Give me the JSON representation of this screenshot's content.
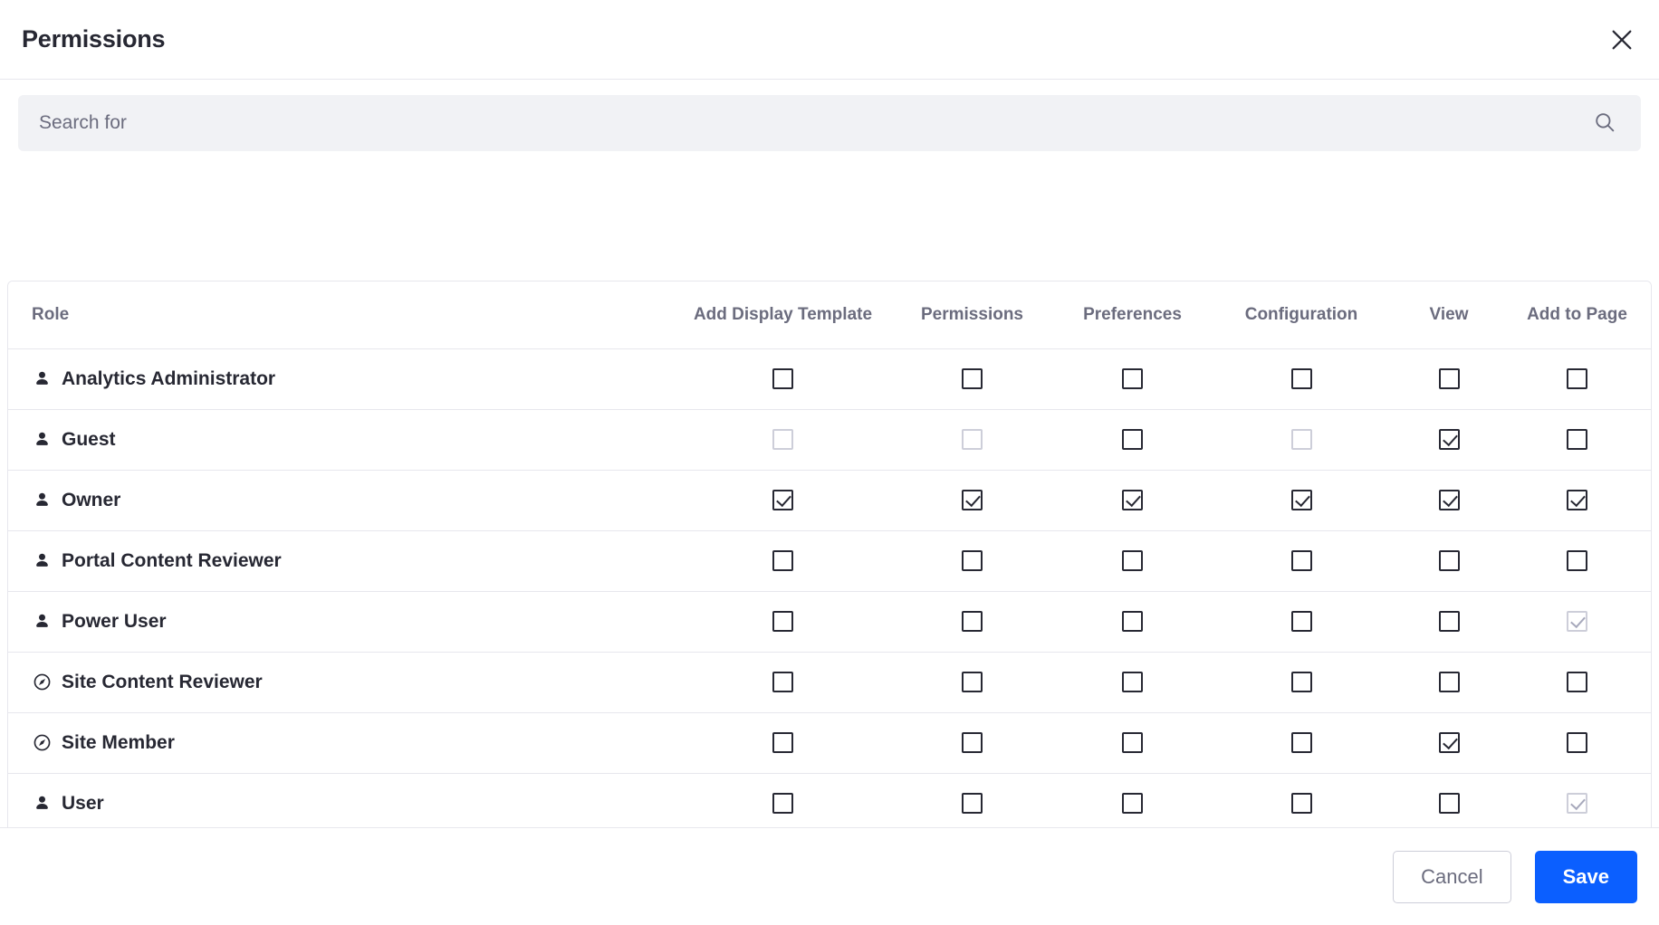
{
  "header": {
    "title": "Permissions",
    "close_icon": "close-icon"
  },
  "search": {
    "placeholder": "Search for",
    "value": "",
    "icon": "search-icon"
  },
  "table": {
    "columns": [
      "Role",
      "Add Display Template",
      "Permissions",
      "Preferences",
      "Configuration",
      "View",
      "Add to Page"
    ],
    "rows": [
      {
        "role": "Analytics Administrator",
        "icon": "user-icon",
        "cells": [
          {
            "checked": false,
            "disabled": false
          },
          {
            "checked": false,
            "disabled": false
          },
          {
            "checked": false,
            "disabled": false
          },
          {
            "checked": false,
            "disabled": false
          },
          {
            "checked": false,
            "disabled": false
          },
          {
            "checked": false,
            "disabled": false
          }
        ]
      },
      {
        "role": "Guest",
        "icon": "user-icon",
        "cells": [
          {
            "checked": false,
            "disabled": true
          },
          {
            "checked": false,
            "disabled": true
          },
          {
            "checked": false,
            "disabled": false
          },
          {
            "checked": false,
            "disabled": true
          },
          {
            "checked": true,
            "disabled": false
          },
          {
            "checked": false,
            "disabled": false
          }
        ]
      },
      {
        "role": "Owner",
        "icon": "user-icon",
        "cells": [
          {
            "checked": true,
            "disabled": false
          },
          {
            "checked": true,
            "disabled": false
          },
          {
            "checked": true,
            "disabled": false
          },
          {
            "checked": true,
            "disabled": false
          },
          {
            "checked": true,
            "disabled": false
          },
          {
            "checked": true,
            "disabled": false
          }
        ]
      },
      {
        "role": "Portal Content Reviewer",
        "icon": "user-icon",
        "cells": [
          {
            "checked": false,
            "disabled": false
          },
          {
            "checked": false,
            "disabled": false
          },
          {
            "checked": false,
            "disabled": false
          },
          {
            "checked": false,
            "disabled": false
          },
          {
            "checked": false,
            "disabled": false
          },
          {
            "checked": false,
            "disabled": false
          }
        ]
      },
      {
        "role": "Power User",
        "icon": "user-icon",
        "cells": [
          {
            "checked": false,
            "disabled": false
          },
          {
            "checked": false,
            "disabled": false
          },
          {
            "checked": false,
            "disabled": false
          },
          {
            "checked": false,
            "disabled": false
          },
          {
            "checked": false,
            "disabled": false
          },
          {
            "checked": true,
            "disabled": true
          }
        ]
      },
      {
        "role": "Site Content Reviewer",
        "icon": "compass-icon",
        "cells": [
          {
            "checked": false,
            "disabled": false
          },
          {
            "checked": false,
            "disabled": false
          },
          {
            "checked": false,
            "disabled": false
          },
          {
            "checked": false,
            "disabled": false
          },
          {
            "checked": false,
            "disabled": false
          },
          {
            "checked": false,
            "disabled": false
          }
        ]
      },
      {
        "role": "Site Member",
        "icon": "compass-icon",
        "cells": [
          {
            "checked": false,
            "disabled": false
          },
          {
            "checked": false,
            "disabled": false
          },
          {
            "checked": false,
            "disabled": false
          },
          {
            "checked": false,
            "disabled": false
          },
          {
            "checked": true,
            "disabled": false
          },
          {
            "checked": false,
            "disabled": false
          }
        ]
      },
      {
        "role": "User",
        "icon": "user-icon",
        "cells": [
          {
            "checked": false,
            "disabled": false
          },
          {
            "checked": false,
            "disabled": false
          },
          {
            "checked": false,
            "disabled": false
          },
          {
            "checked": false,
            "disabled": false
          },
          {
            "checked": false,
            "disabled": false
          },
          {
            "checked": true,
            "disabled": true
          }
        ]
      }
    ]
  },
  "footer": {
    "cancel_label": "Cancel",
    "save_label": "Save"
  },
  "colors": {
    "primary": "#0b5fff",
    "text": "#272833",
    "muted": "#6b6c7e",
    "border": "#e7e7ed",
    "field_bg": "#f1f2f5"
  }
}
